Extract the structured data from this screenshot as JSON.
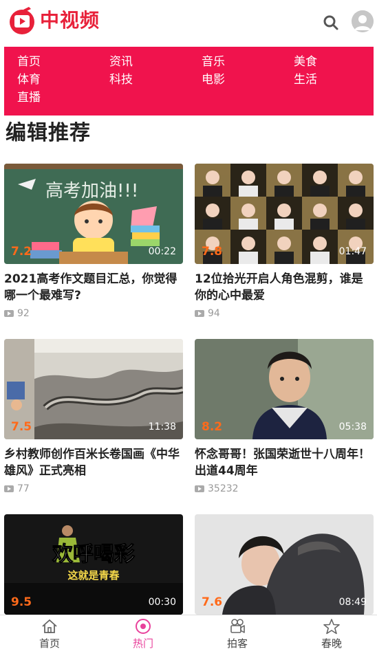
{
  "app": {
    "name": "中视频"
  },
  "header": {
    "logo_text": "中视频"
  },
  "categories": [
    [
      "首页",
      "资讯",
      "音乐",
      "美食"
    ],
    [
      "体育",
      "科技",
      "电影",
      "生活"
    ],
    [
      "直播"
    ]
  ],
  "section": {
    "title": "编辑推荐"
  },
  "videos": [
    {
      "title": "2021高考作文题目汇总，你觉得哪一个最难写?",
      "score": "7.2",
      "duration": "00:22",
      "views": "92"
    },
    {
      "title": "12位拾光开启人角色混剪，谁是你的心中最爱",
      "score": "7.8",
      "duration": "01:47",
      "views": "94"
    },
    {
      "title": "乡村教师创作百米长卷国画《中华雄风》正式亮相",
      "score": "7.5",
      "duration": "11:38",
      "views": "77"
    },
    {
      "title": "怀念哥哥！张国荣逝世十八周年！出道44周年",
      "score": "8.2",
      "duration": "05:38",
      "views": "35232"
    },
    {
      "title": "",
      "score": "9.5",
      "duration": "00:30",
      "views": "",
      "overlay_line1": "欢呼喝彩",
      "overlay_line2": "这就是青春"
    },
    {
      "title": "",
      "score": "7.6",
      "duration": "08:49",
      "views": ""
    }
  ],
  "thumb_text": {
    "v1_chalk": "高考加油!!!"
  },
  "bottom_nav": [
    {
      "label": "首页",
      "icon": "home-icon",
      "active": false
    },
    {
      "label": "热门",
      "icon": "hot-icon",
      "active": true
    },
    {
      "label": "拍客",
      "icon": "camera-icon",
      "active": false
    },
    {
      "label": "春晚",
      "icon": "star-icon",
      "active": false
    }
  ],
  "colors": {
    "brand": "#e8213a",
    "nav_bg": "#f0134d",
    "active_tab": "#e8419b",
    "score": "#ff6a1a"
  }
}
